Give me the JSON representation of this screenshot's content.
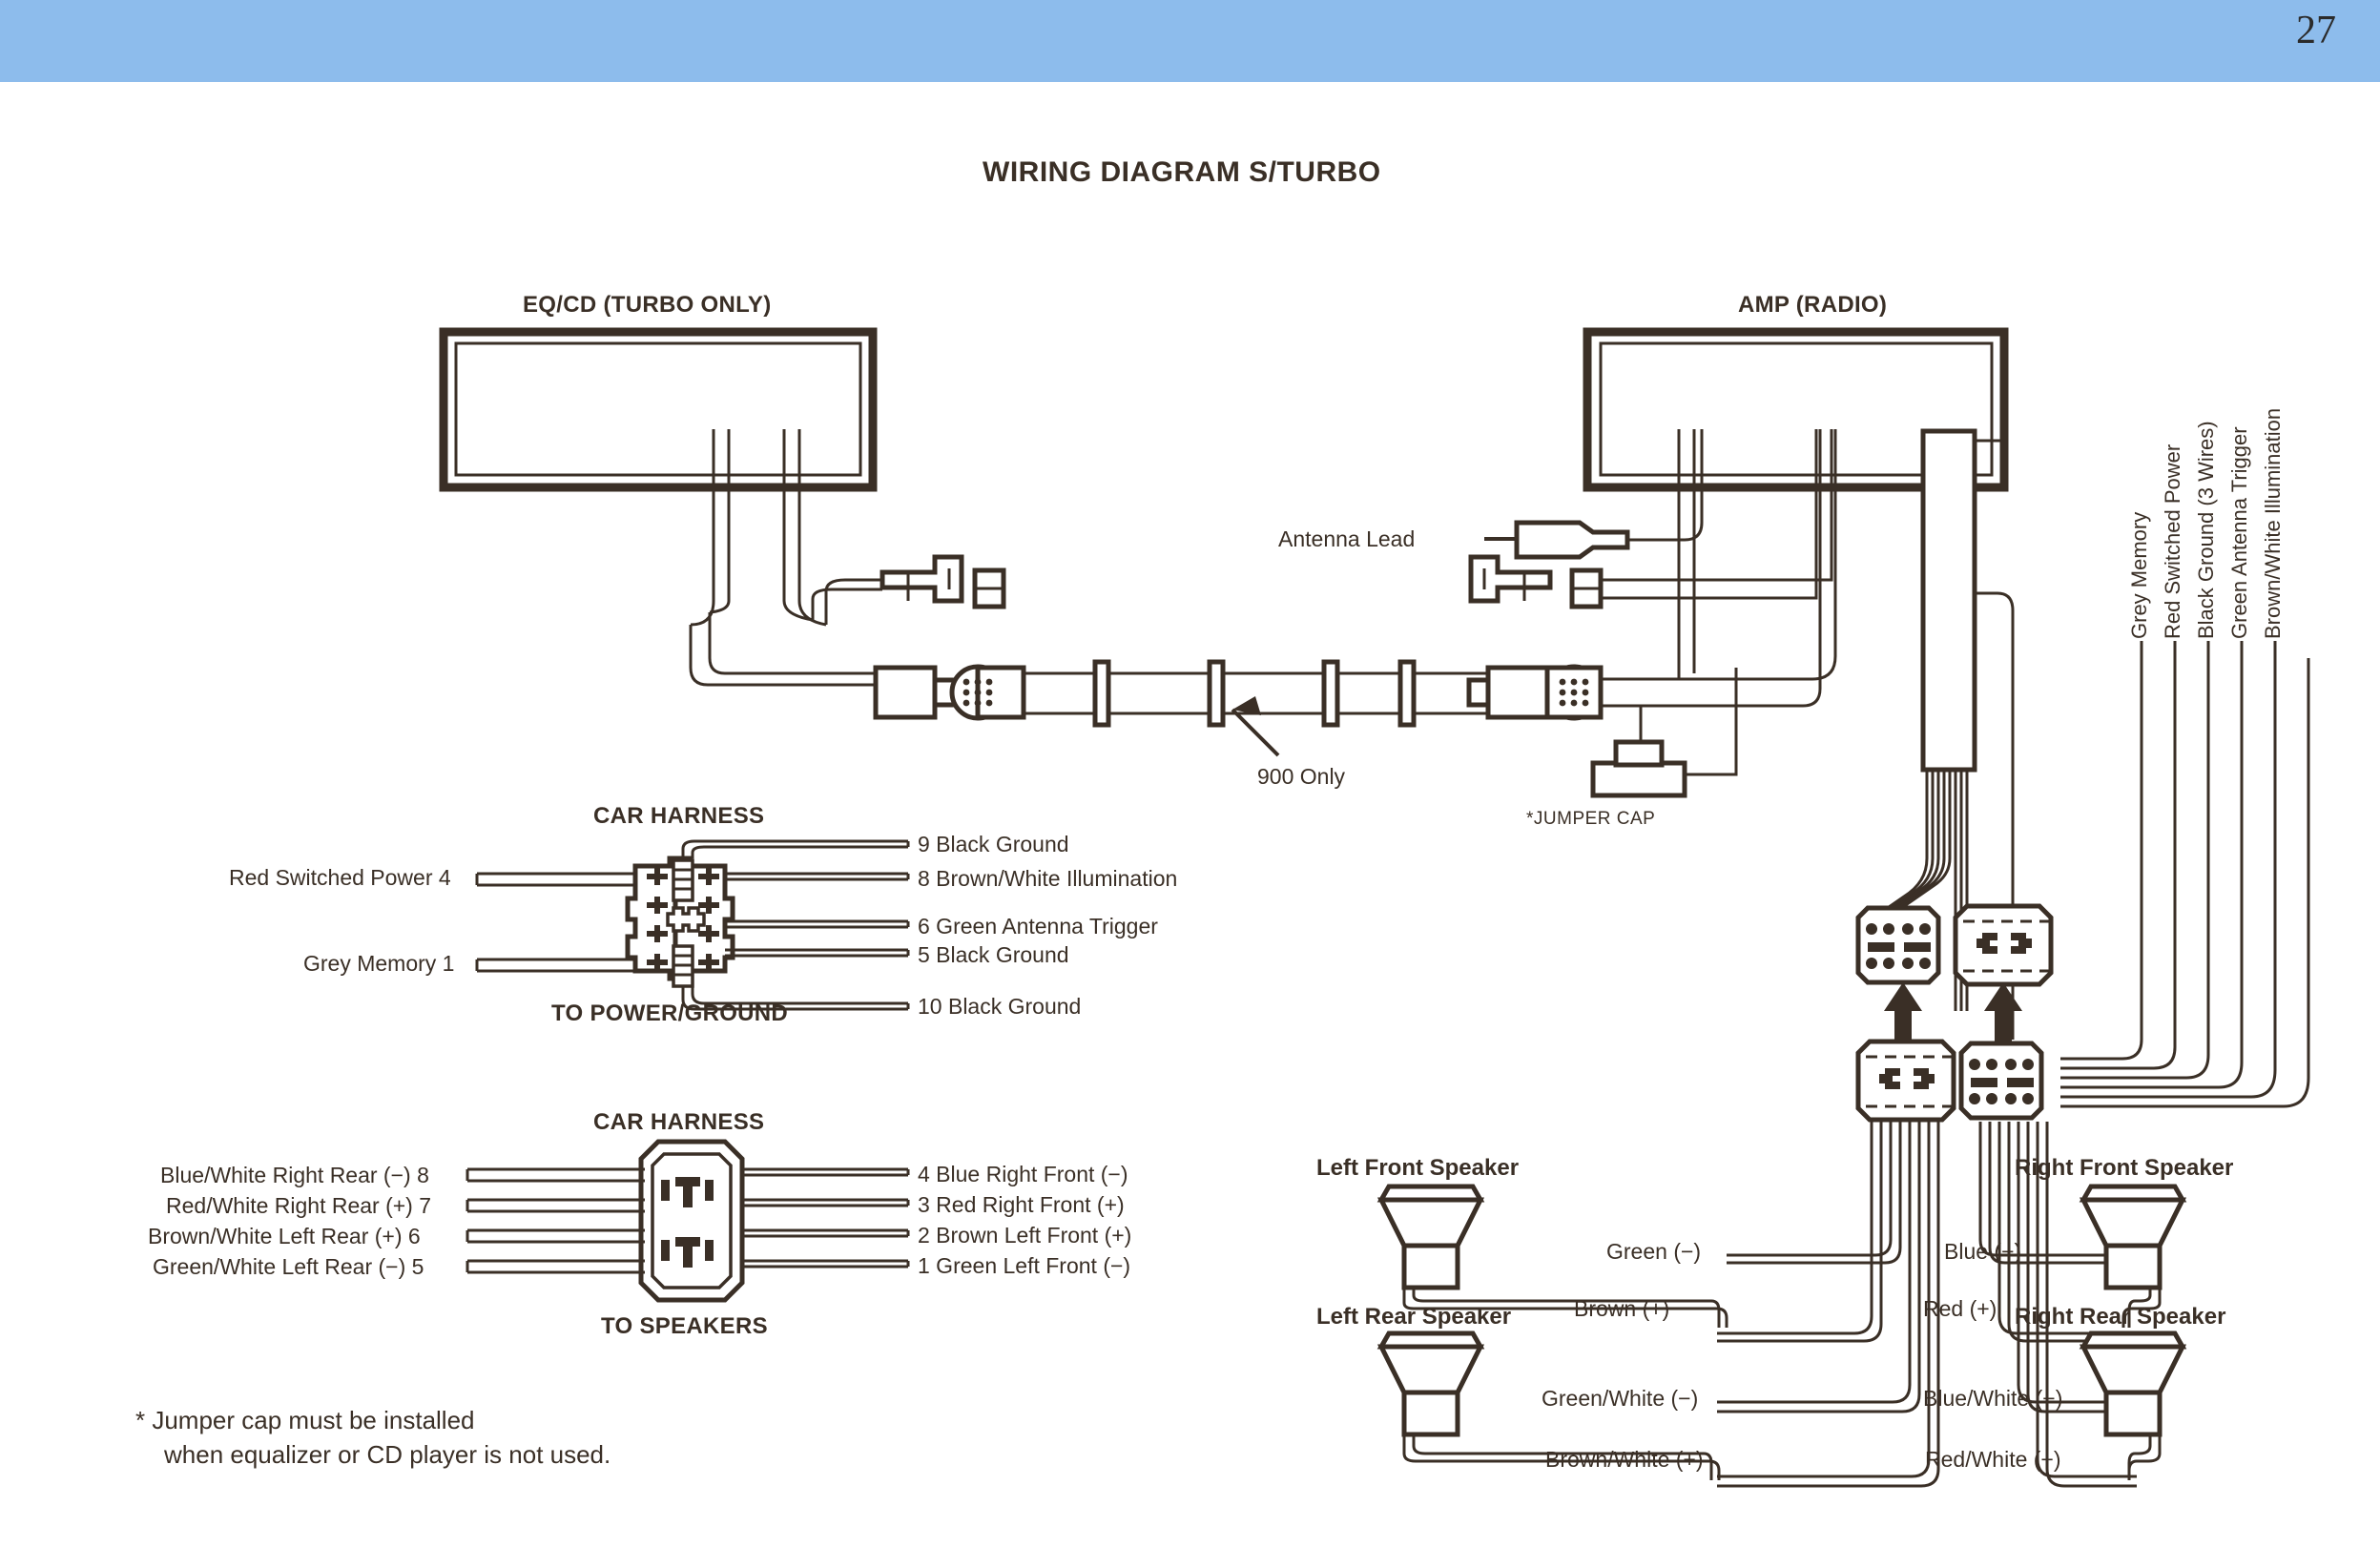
{
  "page": {
    "number": "27",
    "band_color": "#8dbcec",
    "ink_color": "#3a2f26",
    "title": "WIRING DIAGRAM S/TURBO"
  },
  "units": {
    "eq_cd": "EQ/CD (TURBO ONLY)",
    "amp": "AMP (RADIO)"
  },
  "annotations": {
    "antenna_lead": "Antenna Lead",
    "nine_hundred_only": "900 Only",
    "jumper_cap": "*JUMPER CAP"
  },
  "power_harness": {
    "title": "CAR HARNESS",
    "subtitle": "TO POWER/GROUND",
    "left_labels": [
      "Red Switched Power 4",
      "Grey Memory 1"
    ],
    "right_labels": [
      "9 Black Ground",
      "8 Brown/White Illumination",
      "6 Green Antenna Trigger",
      "5 Black Ground",
      "10 Black Ground"
    ]
  },
  "speaker_harness": {
    "title": "CAR HARNESS",
    "subtitle": "TO SPEAKERS",
    "left_labels": [
      "Blue/White Right Rear (−) 8",
      "Red/White Right Rear (+) 7",
      "Brown/White Left Rear (+) 6",
      "Green/White Left Rear (−) 5"
    ],
    "right_labels": [
      "4 Blue Right Front (−)",
      "3 Red Right Front (+)",
      "2 Brown Left Front (+)",
      "1 Green Left Front (−)"
    ]
  },
  "footnote": {
    "line1": "* Jumper cap must be installed",
    "line2": "when equalizer or CD player is not used."
  },
  "vertical_labels": [
    "Grey Memory",
    "Red Switched Power",
    "Black Ground (3 Wires)",
    "Green Antenna Trigger",
    "Brown/White Illumination"
  ],
  "speakers": {
    "left_front": "Left Front Speaker",
    "right_front": "Right Front Speaker",
    "left_rear": "Left Rear Speaker",
    "right_rear": "Right Rear Speaker"
  },
  "speaker_wires": {
    "left_front_neg": "Green (−)",
    "left_front_pos": "Brown (+)",
    "right_front_neg": "Blue (−)",
    "right_front_pos": "Red (+)",
    "left_rear_neg": "Green/White (−)",
    "left_rear_pos": "Brown/White (+)",
    "right_rear_neg": "Blue/White (−)",
    "right_rear_pos": "Red/White (+)"
  }
}
